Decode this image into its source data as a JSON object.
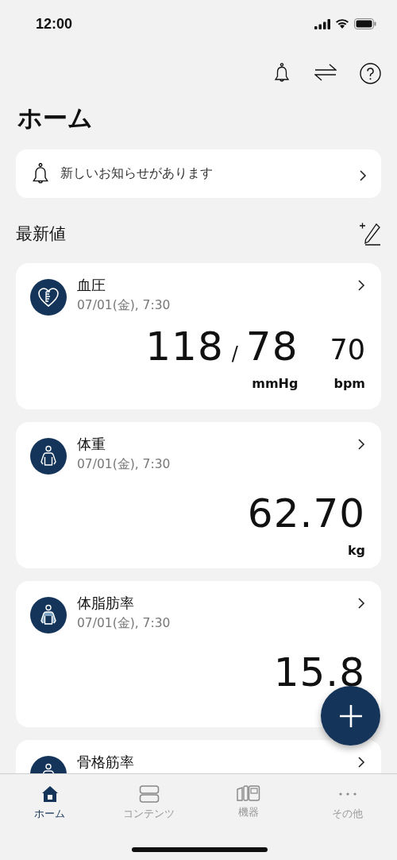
{
  "status_bar": {
    "time": "12:00"
  },
  "page_title": "ホーム",
  "notice": {
    "text": "新しいお知らせがあります"
  },
  "section_title": "最新値",
  "cards": [
    {
      "kind": "blood_pressure",
      "title": "血圧",
      "date": "07/01(金), 7:30",
      "systolic": "118",
      "separator": "/",
      "diastolic": "78",
      "unit": "mmHg",
      "pulse": "70",
      "pulse_unit": "bpm"
    },
    {
      "kind": "weight",
      "title": "体重",
      "date": "07/01(金), 7:30",
      "value": "62.70",
      "unit": "kg"
    },
    {
      "kind": "body_fat",
      "title": "体脂肪率",
      "date": "07/01(金), 7:30",
      "value": "15.8"
    },
    {
      "kind": "skeletal_muscle",
      "title": "骨格筋率"
    }
  ],
  "tabs": [
    {
      "kind": "home",
      "label": "ホーム",
      "selected": true
    },
    {
      "kind": "contents",
      "label": "コンテンツ",
      "selected": false
    },
    {
      "kind": "devices",
      "label": "機器",
      "selected": false
    },
    {
      "kind": "more",
      "label": "その他",
      "selected": false
    }
  ]
}
